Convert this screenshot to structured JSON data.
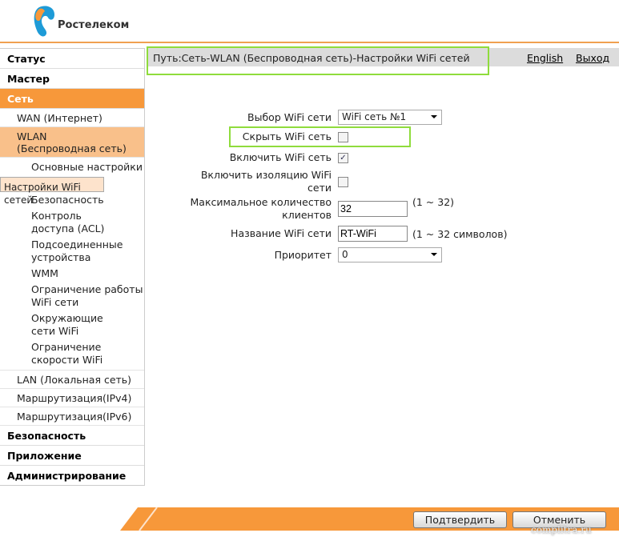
{
  "brand": {
    "name": "Ростелеком",
    "colors": {
      "orange": "#f7983a",
      "blue": "#1e9bd7",
      "highlight": "#8fdc3c"
    }
  },
  "sidebar": {
    "items": [
      "Статус",
      "Мастер",
      "Сеть"
    ],
    "net_sub": [
      "WAN (Интернет)",
      "WLAN (Беспроводная сеть)"
    ],
    "wlan_sub": [
      "Основные настройки",
      "Настройки WiFi сетей",
      "Безопасность",
      "Контроль доступа (ACL)",
      "Подсоединенные устройства",
      "WMM",
      "Ограничение работы WiFi сети",
      "Окружающие сети WiFi",
      "Ограничение скорости WiFi"
    ],
    "net_sub2": [
      "LAN (Локальная сеть)",
      "Маршрутизация(IPv4)",
      "Маршрутизация(IPv6)"
    ],
    "bottom": [
      "Безопасность",
      "Приложение",
      "Администрирование"
    ]
  },
  "header": {
    "path": "Путь:Сеть-WLAN (Беспроводная сеть)-Настройки WiFi сетей",
    "english": "English",
    "logout": "Выход"
  },
  "form": {
    "wifi_select": {
      "label": "Выбор WiFi сети",
      "value": "WiFi сеть №1"
    },
    "hide": {
      "label": "Скрыть WiFi сеть",
      "checked": false
    },
    "enable": {
      "label": "Включить WiFi сеть",
      "checked": true
    },
    "isolation": {
      "label": "Включить изоляцию WiFi сети",
      "checked": false
    },
    "max_clients": {
      "label": "Максимальное количество клиентов",
      "value": "32",
      "hint": "(1 ~ 32)"
    },
    "ssid": {
      "label": "Название WiFi сети",
      "value": "RT-WiFi",
      "hint": "(1 ~ 32 символов)"
    },
    "priority": {
      "label": "Приоритет",
      "value": "0"
    }
  },
  "footer": {
    "confirm": "Подтвердить",
    "cancel": "Отменить",
    "watermark": "complitra.ru"
  }
}
